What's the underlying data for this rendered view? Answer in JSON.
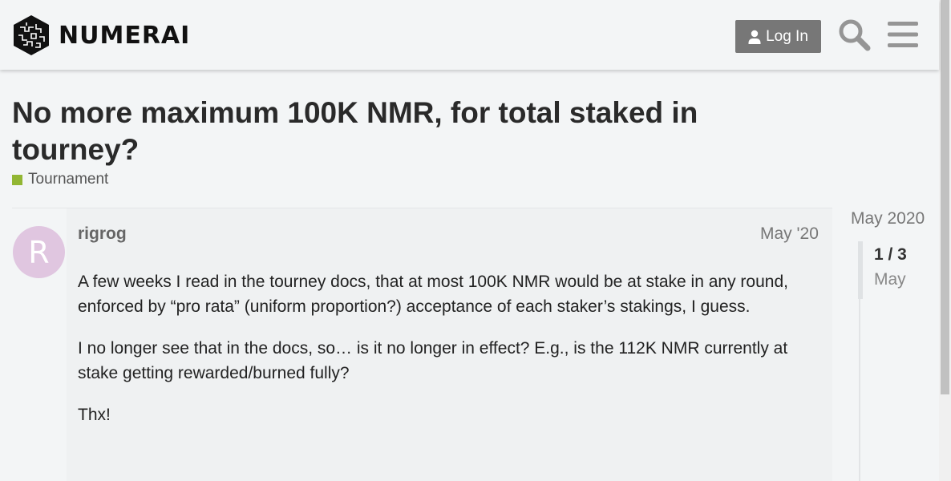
{
  "header": {
    "logo_text": "NUMERAI",
    "login_label": "Log In"
  },
  "topic": {
    "title": "No more maximum 100K NMR, for total staked in tourney?",
    "category": "Tournament",
    "category_color": "#92b633"
  },
  "post": {
    "avatar_letter": "R",
    "avatar_color": "#e0c6e0",
    "username": "rigrog",
    "date": "May '20",
    "paragraphs": [
      "A few weeks I read in the tourney docs, that at most 100K NMR would be at stake in any round, enforced by “pro rata” (uniform proportion?) acceptance of each staker’s stakings, I guess.",
      "I no longer see that in the docs, so… is it no longer in effect? E.g., is the 112K NMR currently at stake getting rewarded/burned fully?",
      "Thx!"
    ]
  },
  "timeline": {
    "start_date": "May 2020",
    "position": "1 / 3",
    "current_date": "May"
  },
  "icons": {
    "logo": "numerai-logo-icon",
    "user": "user-icon",
    "search": "search-icon",
    "menu": "hamburger-menu-icon"
  }
}
